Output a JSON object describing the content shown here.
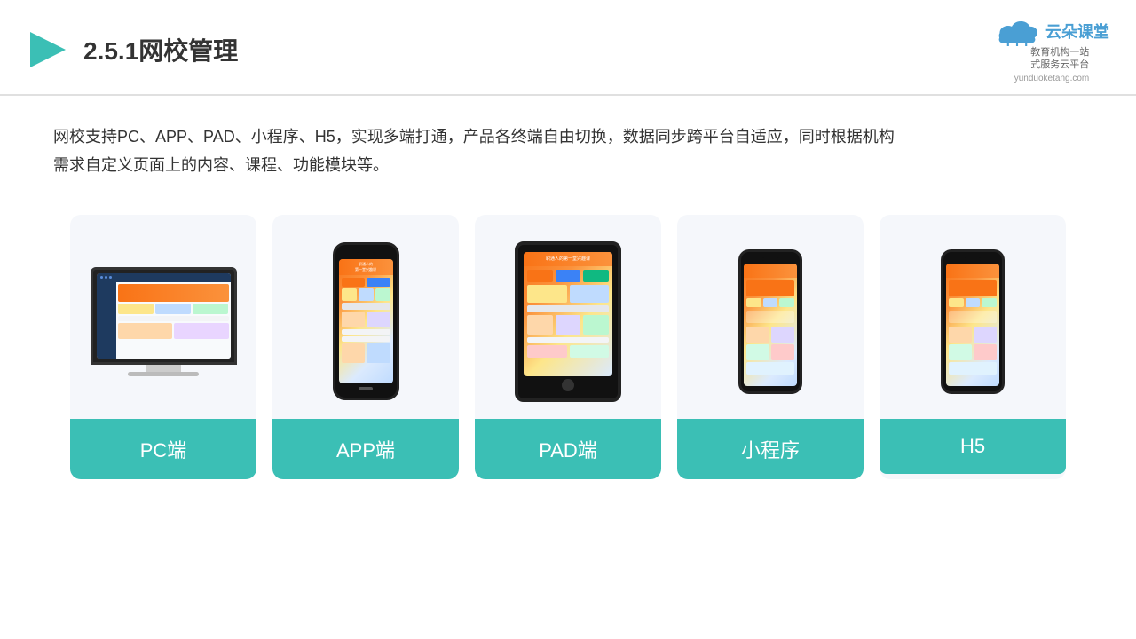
{
  "header": {
    "title": "2.5.1网校管理",
    "logo_text": "云朵课堂",
    "logo_subtitle": "教育机构一站\n式服务云平台",
    "logo_url": "yunduoketang.com"
  },
  "description": {
    "line1": "网校支持PC、APP、PAD、小程序、H5，实现多端打通，产品各终端自由切换，数据同步跨平台自适应，同时根据机构",
    "line2": "需求自定义页面上的内容、课程、功能模块等。"
  },
  "cards": [
    {
      "id": "pc",
      "label": "PC端"
    },
    {
      "id": "app",
      "label": "APP端"
    },
    {
      "id": "pad",
      "label": "PAD端"
    },
    {
      "id": "miniprogram",
      "label": "小程序"
    },
    {
      "id": "h5",
      "label": "H5"
    }
  ],
  "colors": {
    "teal": "#3bbfb5",
    "accent": "#f97316",
    "bg_card": "#f5f7fb",
    "text_dark": "#333333"
  }
}
